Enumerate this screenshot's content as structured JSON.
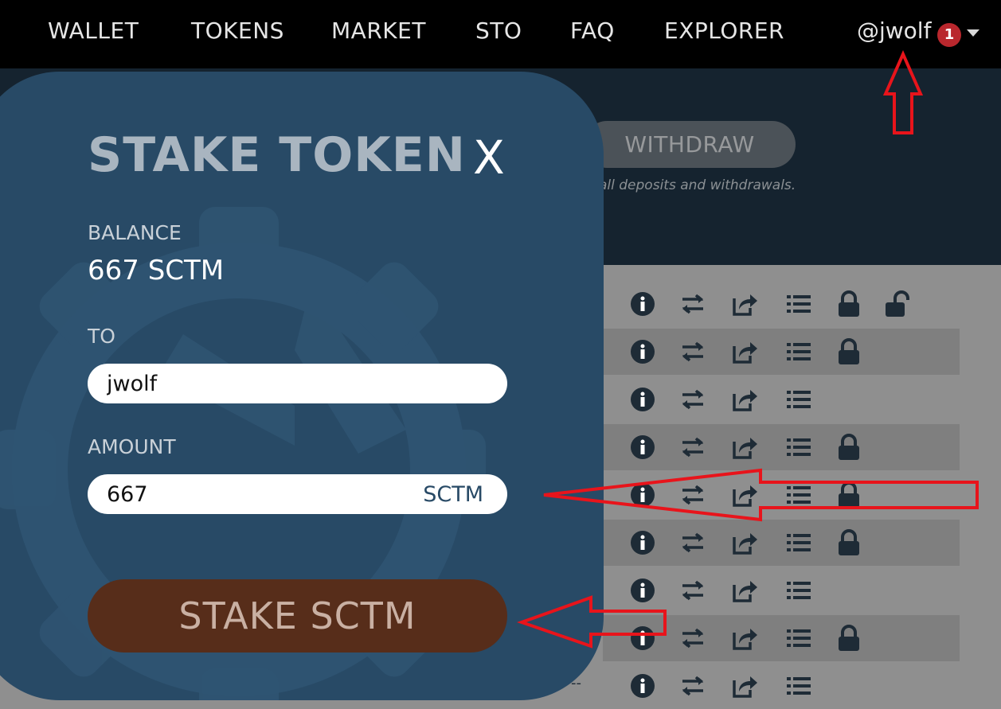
{
  "nav": {
    "items": [
      "WALLET",
      "TOKENS",
      "MARKET",
      "STO",
      "FAQ",
      "EXPLORER"
    ],
    "user": "@jwolf",
    "notification_count": "1"
  },
  "banner": {
    "withdraw_label": "WITHDRAW",
    "subtext": "all deposits and withdrawals."
  },
  "table": {
    "rows": [
      {
        "icons": [
          "info-icon",
          "transfer-icon",
          "share-icon",
          "list-icon",
          "lock-icon",
          "unlock-icon"
        ]
      },
      {
        "icons": [
          "info-icon",
          "transfer-icon",
          "share-icon",
          "list-icon",
          "lock-icon"
        ]
      },
      {
        "icons": [
          "info-icon",
          "transfer-icon",
          "share-icon",
          "list-icon"
        ]
      },
      {
        "icons": [
          "info-icon",
          "transfer-icon",
          "share-icon",
          "list-icon",
          "lock-icon"
        ]
      },
      {
        "icons": [
          "info-icon",
          "transfer-icon",
          "share-icon",
          "list-icon",
          "lock-icon"
        ]
      },
      {
        "icons": [
          "info-icon",
          "transfer-icon",
          "share-icon",
          "list-icon",
          "lock-icon"
        ]
      },
      {
        "icons": [
          "info-icon",
          "transfer-icon",
          "share-icon",
          "list-icon"
        ]
      },
      {
        "icons": [
          "info-icon",
          "transfer-icon",
          "share-icon",
          "list-icon",
          "lock-icon"
        ]
      },
      {
        "icons": [
          "info-icon",
          "transfer-icon",
          "share-icon",
          "list-icon"
        ]
      }
    ],
    "last_row_dash": "--"
  },
  "modal": {
    "title": "STAKE TOKEN",
    "close_label": "X",
    "balance_label": "BALANCE",
    "balance_value": "667 SCTM",
    "to_label": "TO",
    "to_value": "jwolf",
    "amount_label": "AMOUNT",
    "amount_value": "667",
    "amount_unit": "SCTM",
    "stake_button": "STAKE SCTM"
  },
  "colors": {
    "nav_bg": "#000000",
    "modal_bg": "#284a66",
    "stake_button_bg": "#572d1a",
    "annotation_arrow": "#e8141b",
    "notification_badge": "#b9272d"
  }
}
